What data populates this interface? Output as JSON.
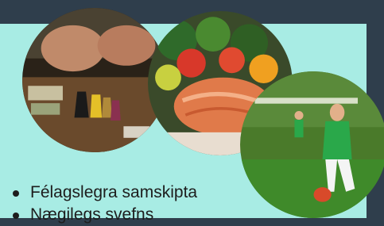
{
  "slide": {
    "bullets": [
      {
        "text": "Félagslegra samskipta"
      },
      {
        "text": "Nægilegs svefns"
      }
    ],
    "photos": [
      {
        "subject": "board-game-players"
      },
      {
        "subject": "salmon-salad-plate"
      },
      {
        "subject": "child-playing-soccer"
      }
    ]
  },
  "colors": {
    "background": "#2f3e4c",
    "panel": "#a8ece4",
    "text": "#1d1d1d"
  }
}
